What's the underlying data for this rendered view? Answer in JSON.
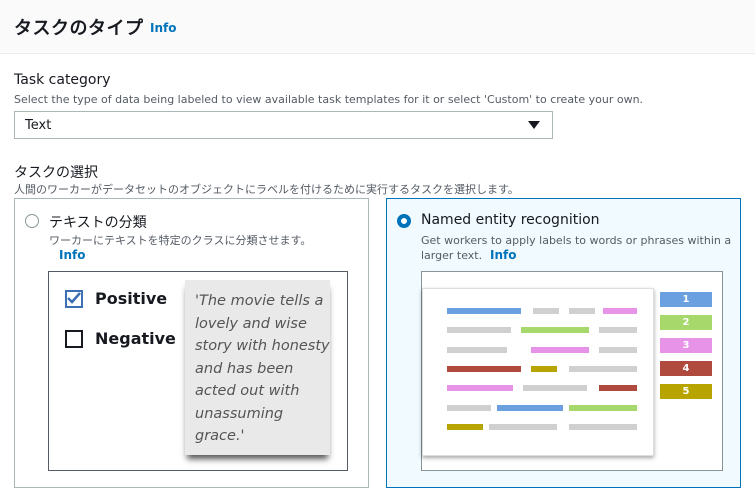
{
  "header": {
    "title": "タスクのタイプ",
    "info": "Info"
  },
  "task_category": {
    "label": "Task category",
    "description": "Select the type of data being labeled to view available task templates for it or select 'Custom' to create your own.",
    "selected": "Text"
  },
  "task_selection": {
    "label": "タスクの選択",
    "description": "人間のワーカーがデータセットのオブジェクトにラベルを付けるために実行するタスクを選択します。"
  },
  "options": [
    {
      "title": "テキストの分類",
      "description": "ワーカーにテキストを特定のクラスに分類させます。",
      "info": "Info",
      "checked": false,
      "illustration": {
        "checkbox_positive": "Positive",
        "checkbox_negative": "Negative",
        "quote": "'The movie tells a lovely and wise story with honesty and has been acted out with unassuming grace.'"
      }
    },
    {
      "title": "Named entity recognition",
      "description_line1": "Get workers to apply labels to words or phrases within a",
      "description_line2": "larger text.",
      "info": "Info",
      "checked": true,
      "illustration": {
        "labels": [
          "1",
          "2",
          "3",
          "4",
          "5"
        ],
        "label_colors": [
          "#6a9fe0",
          "#a6d86b",
          "#e693e8",
          "#b04a3f",
          "#b8a400"
        ],
        "neutral_color": "#d0d0d0"
      }
    }
  ]
}
